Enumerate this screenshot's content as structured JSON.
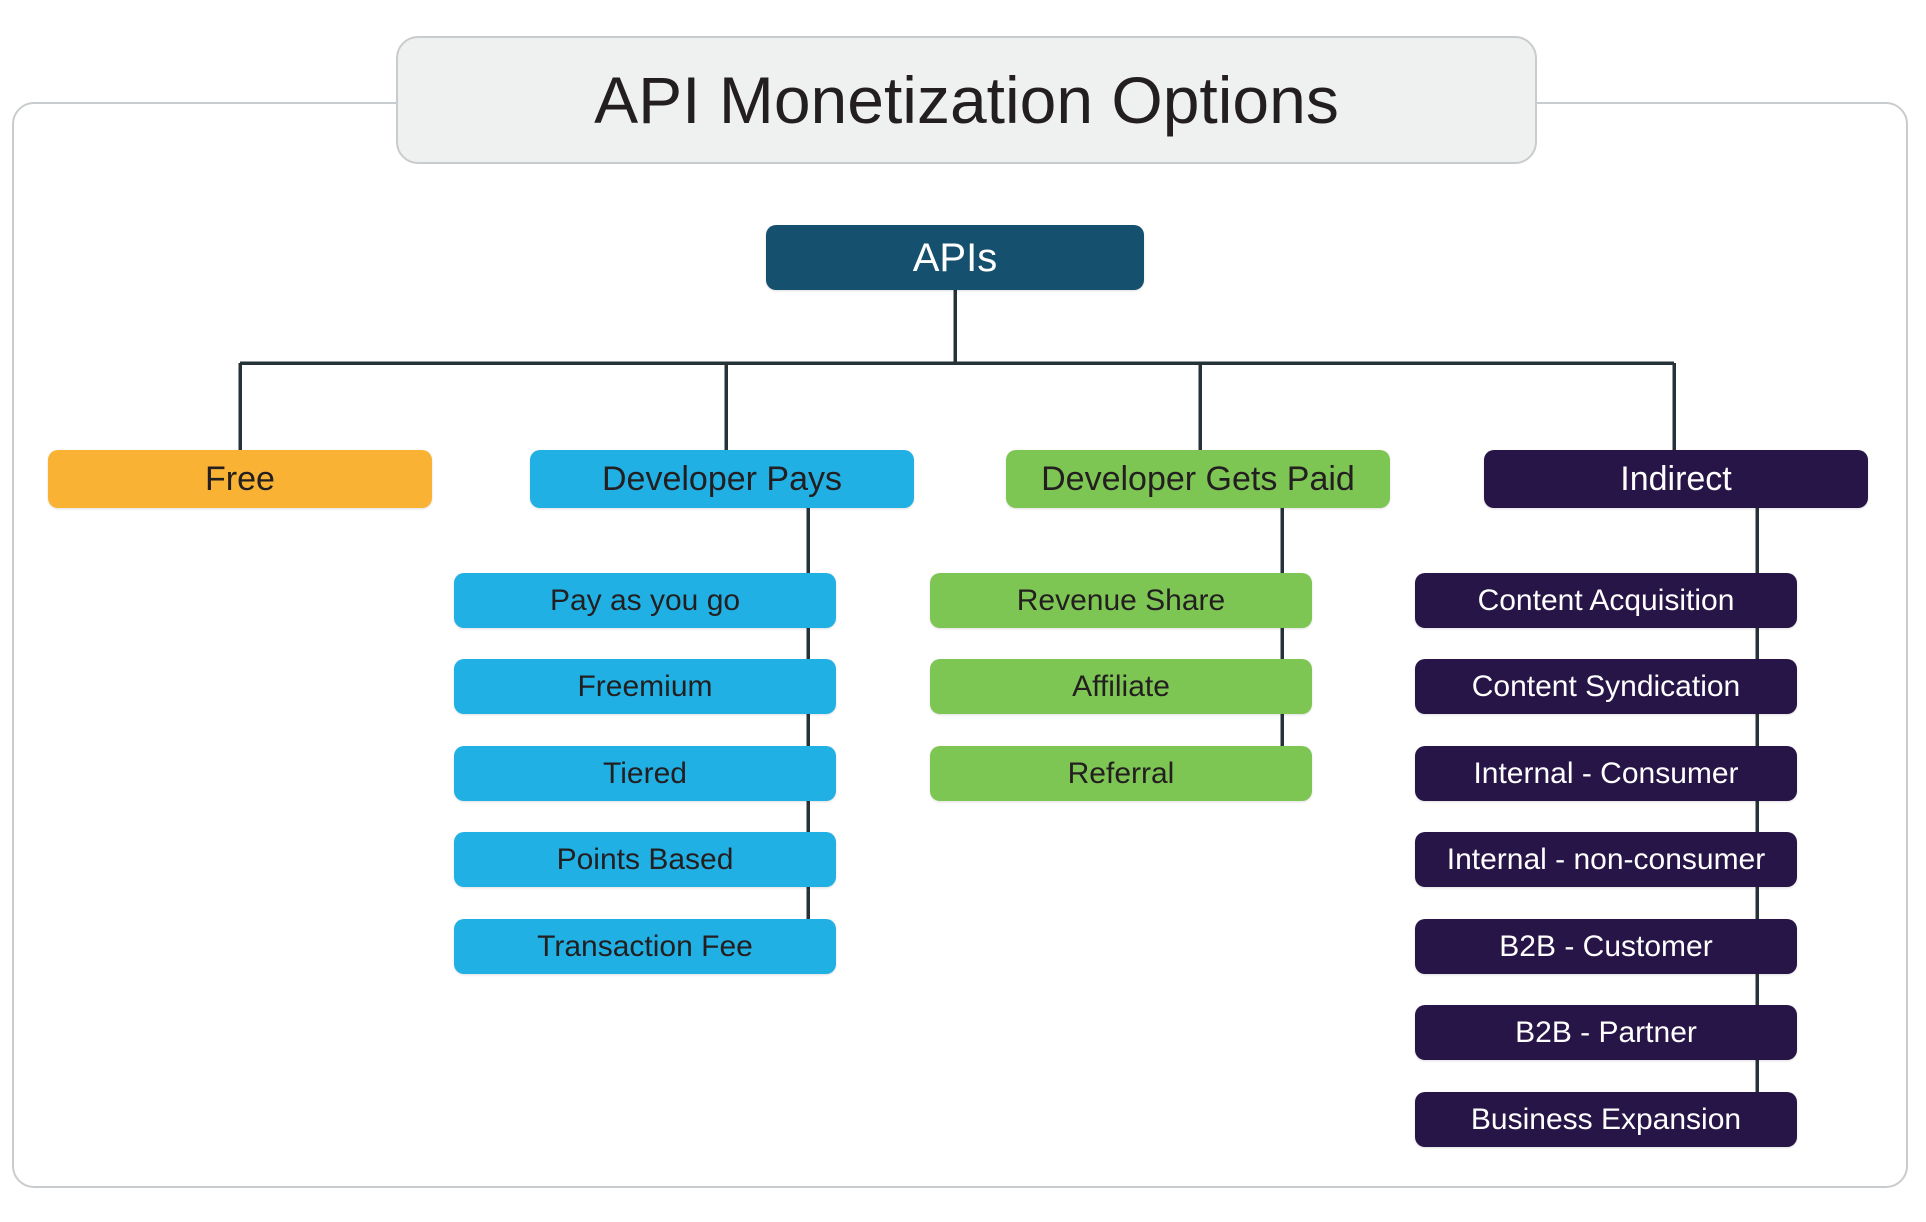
{
  "title": "API Monetization Options",
  "colors": {
    "root": "#15506f",
    "free": "#f9b233",
    "developer_pays": "#21b0e4",
    "developer_gets_paid": "#7ec654",
    "indirect": "#271547",
    "connector": "#253338",
    "frame_border": "#c9ccce",
    "title_fill": "#eff0f0",
    "text_dark": "#231f20",
    "text_light": "#ffffff",
    "page_background": "#ffffff"
  },
  "chart_data": {
    "type": "tree",
    "title": "API Monetization Options",
    "root": "APIs",
    "branches": [
      {
        "label": "Free",
        "color": "#f9b233",
        "children": []
      },
      {
        "label": "Developer Pays",
        "color": "#21b0e4",
        "children": [
          "Pay as you go",
          "Freemium",
          "Tiered",
          "Points Based",
          "Transaction Fee"
        ]
      },
      {
        "label": "Developer Gets Paid",
        "color": "#7ec654",
        "children": [
          "Revenue Share",
          "Affiliate",
          "Referral"
        ]
      },
      {
        "label": "Indirect",
        "color": "#271547",
        "children": [
          "Content Acquisition",
          "Content Syndication",
          "Internal - Consumer",
          "Internal - non-consumer",
          "B2B - Customer",
          "B2B - Partner",
          "Business Expansion"
        ]
      }
    ]
  },
  "tree": {
    "root": {
      "label": "APIs"
    },
    "branch_free": {
      "label": "Free"
    },
    "branch_pays": {
      "label": "Developer Pays"
    },
    "branch_paid": {
      "label": "Developer Gets Paid"
    },
    "branch_indirect": {
      "label": "Indirect"
    },
    "pays_children": [
      {
        "label": "Pay as you go"
      },
      {
        "label": "Freemium"
      },
      {
        "label": "Tiered"
      },
      {
        "label": "Points Based"
      },
      {
        "label": "Transaction Fee"
      }
    ],
    "paid_children": [
      {
        "label": "Revenue Share"
      },
      {
        "label": "Affiliate"
      },
      {
        "label": "Referral"
      }
    ],
    "indirect_children": [
      {
        "label": "Content Acquisition"
      },
      {
        "label": "Content Syndication"
      },
      {
        "label": "Internal - Consumer"
      },
      {
        "label": "Internal - non-consumer"
      },
      {
        "label": "B2B - Customer"
      },
      {
        "label": "B2B - Partner"
      },
      {
        "label": "Business Expansion"
      }
    ]
  }
}
